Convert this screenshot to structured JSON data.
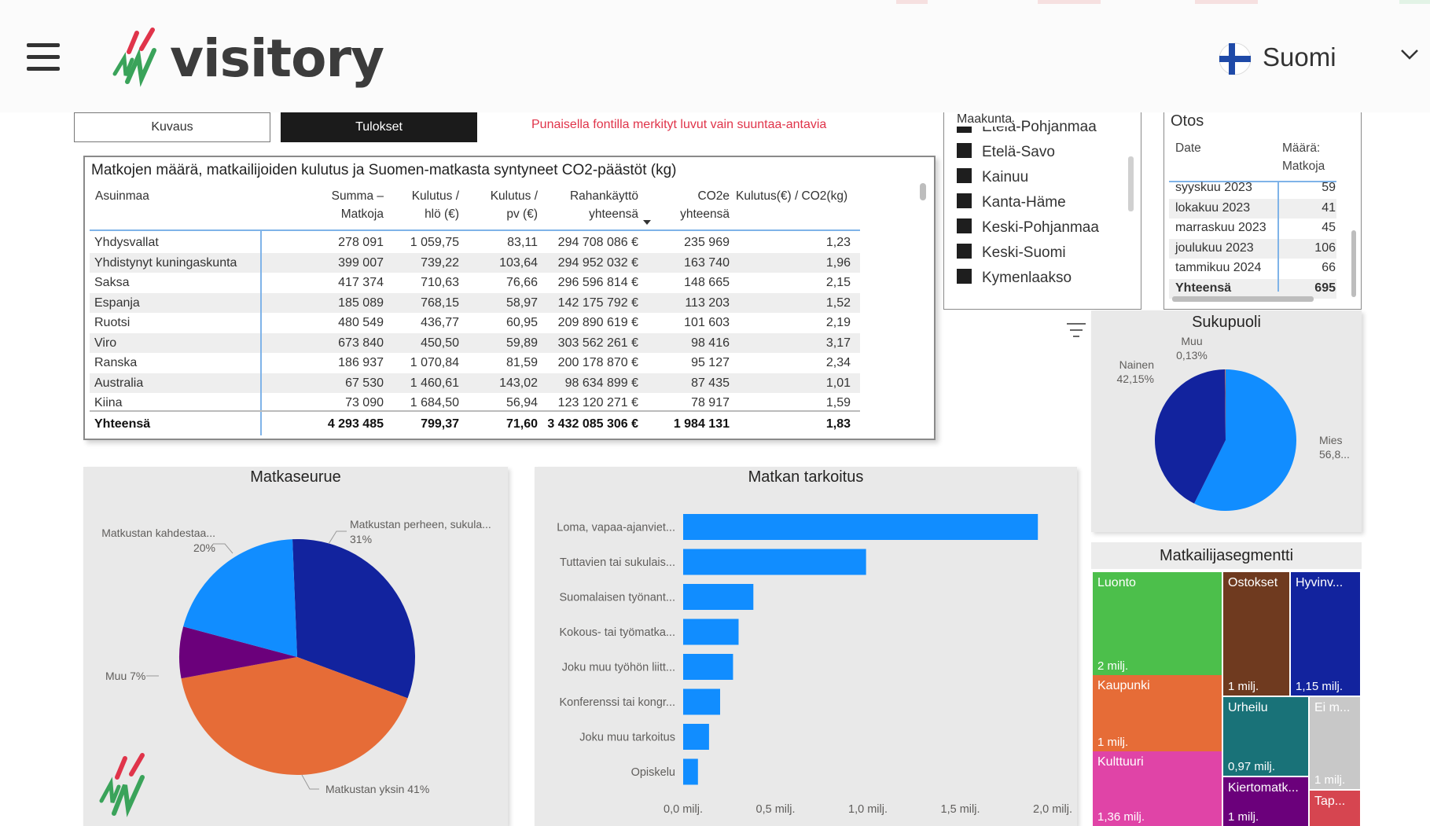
{
  "header": {
    "logo_text": "visitory",
    "language": "Suomi",
    "icons": {
      "menu": "hamburger-menu-icon",
      "flag": "finland-flag-icon",
      "dropdown": "chevron-down-icon"
    }
  },
  "tabs": {
    "kuvaus": "Kuvaus",
    "tulokset": "Tulokset"
  },
  "note": "Punaisella fontilla merkityt luvut vain suuntaa-antavia",
  "main_table": {
    "title": "Matkojen määrä, matkailijoiden kulutus ja Suomen-matkasta syntyneet CO2-päästöt (kg)",
    "headers": {
      "asuinmaa": "Asuinmaa",
      "matkoja_1": "Summa –",
      "matkoja_2": "Matkoja",
      "kulutus_hlo_1": "Kulutus /",
      "kulutus_hlo_2": "hlö (€)",
      "kulutus_pv_1": "Kulutus /",
      "kulutus_pv_2": "pv (€)",
      "rahankaytto_1": "Rahankäyttö",
      "rahankaytto_2": "yhteensä",
      "co2_1": "CO2e",
      "co2_2": "yhteensä",
      "ratio": "Kulutus(€) / CO2(kg)"
    },
    "rows": [
      {
        "country": "Yhdysvallat",
        "matkoja": "278 091",
        "hlo": "1 059,75",
        "pv": "83,11",
        "raha": "294 708 086 €",
        "co2": "235 969",
        "ratio": "1,23"
      },
      {
        "country": "Yhdistynyt kuningaskunta",
        "matkoja": "399 007",
        "hlo": "739,22",
        "pv": "103,64",
        "raha": "294 952 032 €",
        "co2": "163 740",
        "ratio": "1,96"
      },
      {
        "country": "Saksa",
        "matkoja": "417 374",
        "hlo": "710,63",
        "pv": "76,66",
        "raha": "296 596 814 €",
        "co2": "148 665",
        "ratio": "2,15"
      },
      {
        "country": "Espanja",
        "matkoja": "185 089",
        "hlo": "768,15",
        "pv": "58,97",
        "raha": "142 175 792 €",
        "co2": "113 203",
        "ratio": "1,52"
      },
      {
        "country": "Ruotsi",
        "matkoja": "480 549",
        "hlo": "436,77",
        "pv": "60,95",
        "raha": "209 890 619 €",
        "co2": "101 603",
        "ratio": "2,19"
      },
      {
        "country": "Viro",
        "matkoja": "673 840",
        "hlo": "450,50",
        "pv": "59,89",
        "raha": "303 562 261 €",
        "co2": "98 416",
        "ratio": "3,17"
      },
      {
        "country": "Ranska",
        "matkoja": "186 937",
        "hlo": "1 070,84",
        "pv": "81,59",
        "raha": "200 178 870 €",
        "co2": "95 127",
        "ratio": "2,34"
      },
      {
        "country": "Australia",
        "matkoja": "67 530",
        "hlo": "1 460,61",
        "pv": "143,02",
        "raha": "98 634 899 €",
        "co2": "87 435",
        "ratio": "1,01"
      },
      {
        "country": "Kiina",
        "matkoja": "73 090",
        "hlo": "1 684,50",
        "pv": "56,94",
        "raha": "123 120 271 €",
        "co2": "78 917",
        "ratio": "1,59"
      }
    ],
    "total": {
      "country": "Yhteensä",
      "matkoja": "4 293 485",
      "hlo": "799,37",
      "pv": "71,60",
      "raha": "3 432 085 306 €",
      "co2": "1 984 131",
      "ratio": "1,83"
    }
  },
  "maakunta": {
    "title": "Maakunta",
    "items": [
      "Etelä-Pohjanmaa",
      "Etelä-Savo",
      "Kainuu",
      "Kanta-Häme",
      "Keski-Pohjanmaa",
      "Keski-Suomi",
      "Kymenlaakso"
    ]
  },
  "otos": {
    "title": "Otos",
    "col_date": "Date",
    "col_count_1": "Määrä:",
    "col_count_2": "Matkoja",
    "rows": [
      {
        "date": "syyskuu 2023",
        "count": "59"
      },
      {
        "date": "lokakuu 2023",
        "count": "41"
      },
      {
        "date": "marraskuu 2023",
        "count": "45"
      },
      {
        "date": "joulukuu 2023",
        "count": "106"
      },
      {
        "date": "tammikuu 2024",
        "count": "66"
      }
    ],
    "total": {
      "label": "Yhteensä",
      "count": "695"
    }
  },
  "visual_icons": {
    "filter": "filter-icon",
    "focus_mode": "focus-mode-icon"
  },
  "charts": {
    "sukupuoli_title": "Sukupuoli",
    "matkaseurue_title": "Matkaseurue",
    "matkan_title": "Matkan tarkoitus",
    "segment_title": "Matkailijasegmentti"
  },
  "chart_data": [
    {
      "type": "pie",
      "title": "Sukupuoli",
      "slices": [
        {
          "label": "Mies",
          "pct_label": "56,8...",
          "value": 56.8,
          "color": "#118dff"
        },
        {
          "label": "Nainen",
          "pct_label": "42,15%",
          "value": 42.15,
          "color": "#12239e"
        },
        {
          "label": "Muu",
          "pct_label": "0,13%",
          "value": 0.13,
          "color": "#e66c37"
        }
      ]
    },
    {
      "type": "pie",
      "title": "Matkaseurue",
      "slices": [
        {
          "label": "Matkustan perheen, sukula...",
          "pct_label": "31%",
          "value": 31,
          "color": "#12239e"
        },
        {
          "label": "Matkustan yksin",
          "pct_label": "41%",
          "value": 41,
          "color": "#e66c37"
        },
        {
          "label": "Muu",
          "pct_label": "7%",
          "value": 7,
          "color": "#6b007b"
        },
        {
          "label": "Matkustan kahdestaa...",
          "pct_label": "20%",
          "value": 20,
          "color": "#118dff"
        }
      ]
    },
    {
      "type": "bar",
      "orientation": "horizontal",
      "title": "Matkan tarkoitus",
      "categories": [
        "Loma, vapaa-ajanviet...",
        "Tuttavien tai sukulais...",
        "Suomalaisen työnant...",
        "Kokous- tai työmatka...",
        "Joku muu työhön liitt...",
        "Konferenssi tai kongr...",
        "Joku muu tarkoitus",
        "Opiskelu"
      ],
      "values": [
        1.92,
        0.99,
        0.38,
        0.3,
        0.27,
        0.2,
        0.14,
        0.08
      ],
      "unit": "milj.",
      "xlim": [
        0,
        2.0
      ],
      "xticks": [
        "0,0 milj.",
        "0,5 milj.",
        "1,0 milj.",
        "1,5 milj.",
        "2,0 milj."
      ],
      "color": "#118dff"
    },
    {
      "type": "treemap",
      "title": "Matkailijasegmentti",
      "items": [
        {
          "label": "Luonto",
          "value_label": "2 milj.",
          "value": 2.0,
          "color": "#4cbf4b"
        },
        {
          "label": "Kaupunki",
          "value_label": "1 milj.",
          "value": 1.0,
          "color": "#e66c37"
        },
        {
          "label": "Kulttuuri",
          "value_label": "1,36 milj.",
          "value": 1.36,
          "color": "#e044a7"
        },
        {
          "label": "Ostokset",
          "value_label": "1 milj.",
          "value": 1.0,
          "color": "#744ec2"
        },
        {
          "label": "Hyvinv...",
          "value_label": "1,15 milj.",
          "value": 1.15,
          "color": "#12239e"
        },
        {
          "label": "Urheilu",
          "value_label": "0,97 milj.",
          "value": 0.97,
          "color": "#197278"
        },
        {
          "label": "Ei m...",
          "value_label": "1 milj.",
          "value": 1.0,
          "color": "#c8c8c8"
        },
        {
          "label": "Kiertomatk...",
          "value_label": "1 milj.",
          "value": 1.0,
          "color": "#6b007b"
        },
        {
          "label": "Tap...",
          "value_label": "",
          "value": 0.4,
          "color": "#d64550"
        }
      ]
    }
  ]
}
